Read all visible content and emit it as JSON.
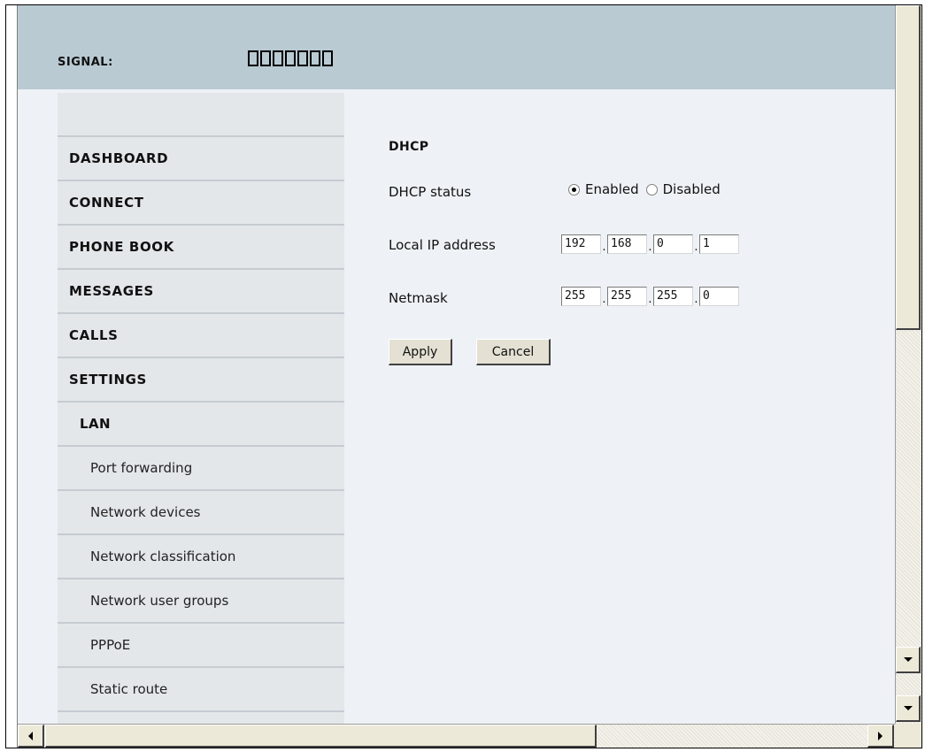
{
  "header": {
    "signal_label": "SIGNAL:",
    "signal_bars_total": 7,
    "signal_bars_filled": 0
  },
  "nav": {
    "items": [
      {
        "label": "DASHBOARD",
        "level": 1
      },
      {
        "label": "CONNECT",
        "level": 1
      },
      {
        "label": "PHONE BOOK",
        "level": 1
      },
      {
        "label": "MESSAGES",
        "level": 1
      },
      {
        "label": "CALLS",
        "level": 1
      },
      {
        "label": "SETTINGS",
        "level": 1
      },
      {
        "label": "LAN",
        "level": 2
      },
      {
        "label": "Port forwarding",
        "level": 3
      },
      {
        "label": "Network devices",
        "level": 3
      },
      {
        "label": "Network classification",
        "level": 3
      },
      {
        "label": "Network user groups",
        "level": 3
      },
      {
        "label": "PPPoE",
        "level": 3
      },
      {
        "label": "Static route",
        "level": 3
      }
    ]
  },
  "dhcp": {
    "title": "DHCP",
    "status_label": "DHCP status",
    "status_options": [
      {
        "label": "Enabled",
        "checked": true
      },
      {
        "label": "Disabled",
        "checked": false
      }
    ],
    "local_ip_label": "Local IP address",
    "local_ip": [
      "192",
      "168",
      "0",
      "1"
    ],
    "netmask_label": "Netmask",
    "netmask": [
      "255",
      "255",
      "255",
      "0"
    ],
    "apply_label": "Apply",
    "cancel_label": "Cancel"
  },
  "colors": {
    "header_bg": "#b9cad3",
    "nav_bg": "#e4e7ea",
    "content_bg": "#eef2f6"
  }
}
